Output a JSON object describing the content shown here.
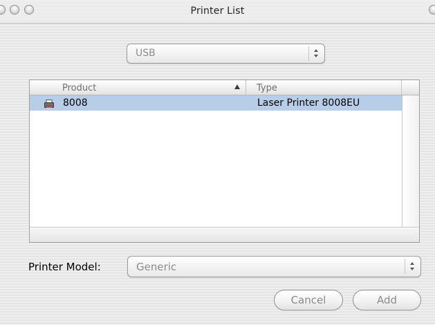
{
  "window": {
    "title": "Printer List"
  },
  "connection_popup": {
    "value": "USB"
  },
  "printer_table": {
    "columns": [
      "Product",
      "Type"
    ],
    "rows": [
      {
        "product": "8008",
        "type": "Laser Printer 8008EU",
        "icon": "printer-icon"
      }
    ]
  },
  "printer_model": {
    "label": "Printer Model:",
    "value": "Generic"
  },
  "buttons": {
    "cancel": "Cancel",
    "add": "Add"
  },
  "colors": {
    "selection": "#b7cde8"
  }
}
